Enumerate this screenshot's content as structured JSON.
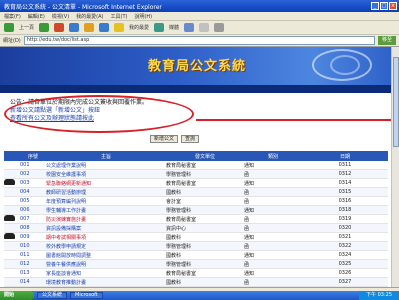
{
  "window": {
    "title": "教育局公文系統 - 公文清單 - Microsoft Internet Explorer",
    "minimize": "_",
    "maximize": "□",
    "close": "×"
  },
  "menubar": [
    "檔案(F)",
    "編輯(E)",
    "檢視(V)",
    "我的最愛(A)",
    "工具(T)",
    "說明(H)"
  ],
  "toolbar": {
    "back": "上一頁",
    "favorites": "我的最愛",
    "media": "媒體"
  },
  "addressbar": {
    "label": "網址(D)",
    "url": "http://edu.tw/doc/list.asp",
    "go": "移至"
  },
  "banner": {
    "title": "教育局公文系統"
  },
  "notice": {
    "line1": "公告：請各單位於期限內完成公文簽收與回覆作業。",
    "line2": "新增公文請點選「新增公文」按鈕",
    "line3": "查看所有公文及辦理狀態請按此"
  },
  "buttons": {
    "add": "新增公文",
    "query": "查詢"
  },
  "table": {
    "headers": [
      "",
      "序號",
      "主旨",
      "發文單位",
      "類別",
      "日期"
    ],
    "rows": [
      {
        "phone": false,
        "id": "001",
        "name": "公文處理作業說明",
        "name_red": false,
        "dept": "教育局秘書室",
        "role": "通知",
        "date": "0311"
      },
      {
        "phone": false,
        "id": "002",
        "name": "校園安全維護事項",
        "name_red": false,
        "dept": "學務管理科",
        "role": "函",
        "date": "0312"
      },
      {
        "phone": true,
        "id": "003",
        "name": "緊急聯絡網更新通知",
        "name_red": true,
        "dept": "教育局秘書室",
        "role": "通知",
        "date": "0314"
      },
      {
        "phone": false,
        "id": "004",
        "name": "教師研習活動辦理",
        "name_red": false,
        "dept": "國教科",
        "role": "函",
        "date": "0315"
      },
      {
        "phone": false,
        "id": "005",
        "name": "年度預算編列說明",
        "name_red": false,
        "dept": "會計室",
        "role": "函",
        "date": "0316"
      },
      {
        "phone": false,
        "id": "006",
        "name": "學生輔導工作計畫",
        "name_red": false,
        "dept": "學務管理科",
        "role": "通知",
        "date": "0318"
      },
      {
        "phone": true,
        "id": "007",
        "name": "防災演練實施計畫",
        "name_red": true,
        "dept": "教育局秘書室",
        "role": "函",
        "date": "0319"
      },
      {
        "phone": false,
        "id": "008",
        "name": "資訊設備採購案",
        "name_red": false,
        "dept": "資訊中心",
        "role": "函",
        "date": "0320"
      },
      {
        "phone": true,
        "id": "009",
        "name": "期中考試相關事項",
        "name_red": true,
        "dept": "國教科",
        "role": "通知",
        "date": "0321"
      },
      {
        "phone": false,
        "id": "010",
        "name": "校外教學申請規定",
        "name_red": false,
        "dept": "學務管理科",
        "role": "函",
        "date": "0322"
      },
      {
        "phone": false,
        "id": "011",
        "name": "圖書館開放時間調整",
        "name_red": false,
        "dept": "國教科",
        "role": "通知",
        "date": "0324"
      },
      {
        "phone": false,
        "id": "012",
        "name": "營養午餐供應說明",
        "name_red": false,
        "dept": "學務管理科",
        "role": "函",
        "date": "0325"
      },
      {
        "phone": false,
        "id": "013",
        "name": "家長座談會通知",
        "name_red": false,
        "dept": "教育局秘書室",
        "role": "通知",
        "date": "0326"
      },
      {
        "phone": false,
        "id": "014",
        "name": "環境教育推動計畫",
        "name_red": false,
        "dept": "國教科",
        "role": "函",
        "date": "0327"
      }
    ]
  },
  "taskbar": {
    "start": "開始",
    "task1": "公文系統",
    "task2": "Microsoft",
    "clock": "下午 03:25"
  },
  "colors": {
    "banner": "#2d5ec8",
    "callout": "#d8202a",
    "link": "#1a3fb0",
    "alert": "#c8102e"
  }
}
